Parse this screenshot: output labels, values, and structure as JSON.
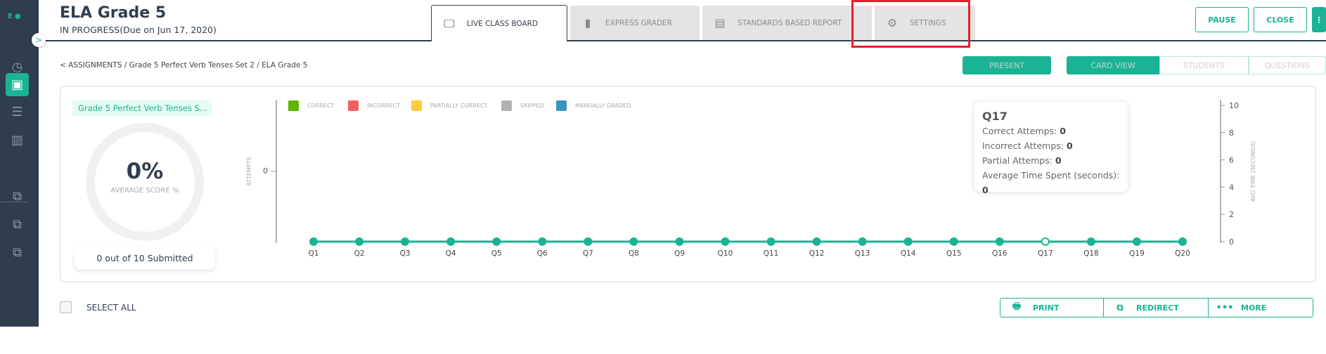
{
  "logo": "E",
  "sidebar": {
    "icons": [
      "dashboard-icon",
      "assignment-clipboard-icon",
      "layers-icon",
      "bar-chart-icon",
      "question-bank-icon",
      "item-bank-icon",
      "test-library-icon"
    ],
    "active": 1
  },
  "header": {
    "title": "ELA Grade 5",
    "subtitle": "IN PROGRESS(Due on Jun 17, 2020)"
  },
  "tabs": [
    {
      "label": "LIVE CLASS BOARD",
      "icon": "monitor-icon",
      "active": true
    },
    {
      "label": "EXPRESS GRADER",
      "icon": "book-icon"
    },
    {
      "label": "STANDARDS BASED REPORT",
      "icon": "clipboard-icon"
    },
    {
      "label": "SETTINGS",
      "icon": "gear-icon"
    }
  ],
  "actions": {
    "pause": "PAUSE",
    "close": "CLOSE",
    "more": "⋮"
  },
  "breadcrumb": "<  ASSIGNMENTS / Grade 5 Perfect Verb Tenses Set 2 / ELA Grade 5",
  "present": "PRESENT",
  "views": [
    "CARD VIEW",
    "STUDENTS",
    "QUESTIONS"
  ],
  "summary": {
    "assignment_tag": "Grade 5 Perfect Verb Tenses S...",
    "score": "0%",
    "score_label": "AVERAGE SCORE %",
    "submitted": "0 out of 10 Submitted"
  },
  "chart_data": {
    "type": "bar+line",
    "legend": [
      {
        "name": "CORRECT",
        "color": "#5cb500"
      },
      {
        "name": "INCORRECT",
        "color": "#f35f5f"
      },
      {
        "name": "PARTIALLY CORRECT",
        "color": "#fdcc3b"
      },
      {
        "name": "SKIPPED",
        "color": "#b1b1b1"
      },
      {
        "name": "MANUALLY GRADED",
        "color": "#3993be"
      }
    ],
    "categories": [
      "Q1",
      "Q2",
      "Q3",
      "Q4",
      "Q5",
      "Q6",
      "Q7",
      "Q8",
      "Q9",
      "Q10",
      "Q11",
      "Q12",
      "Q13",
      "Q14",
      "Q15",
      "Q16",
      "Q17",
      "Q18",
      "Q19",
      "Q20"
    ],
    "avg_time": [
      0,
      0,
      0,
      0,
      0,
      0,
      0,
      0,
      0,
      0,
      0,
      0,
      0,
      0,
      0,
      0,
      0,
      0,
      0,
      0
    ],
    "line_color": "#1ab394",
    "ylabel_left": "ATTEMPTS",
    "yticks_left": [
      "0"
    ],
    "ylabel_right": "AVG TIME (SECONDS)",
    "yticks_right": [
      "0",
      "2",
      "4",
      "6",
      "8",
      "10"
    ],
    "ylim_right": [
      0,
      10
    ],
    "highlighted": "Q17"
  },
  "tooltip": {
    "title": "Q17",
    "rows": [
      {
        "label": "Correct Attemps: ",
        "value": "0"
      },
      {
        "label": "Incorrect Attemps: ",
        "value": "0"
      },
      {
        "label": "Partial Attemps: ",
        "value": "0"
      },
      {
        "label": "Average Time Spent (seconds): ",
        "value": "0"
      }
    ]
  },
  "footer": {
    "select_all": "SELECT ALL",
    "print": "PRINT",
    "redirect": "REDIRECT",
    "more": "MORE"
  }
}
